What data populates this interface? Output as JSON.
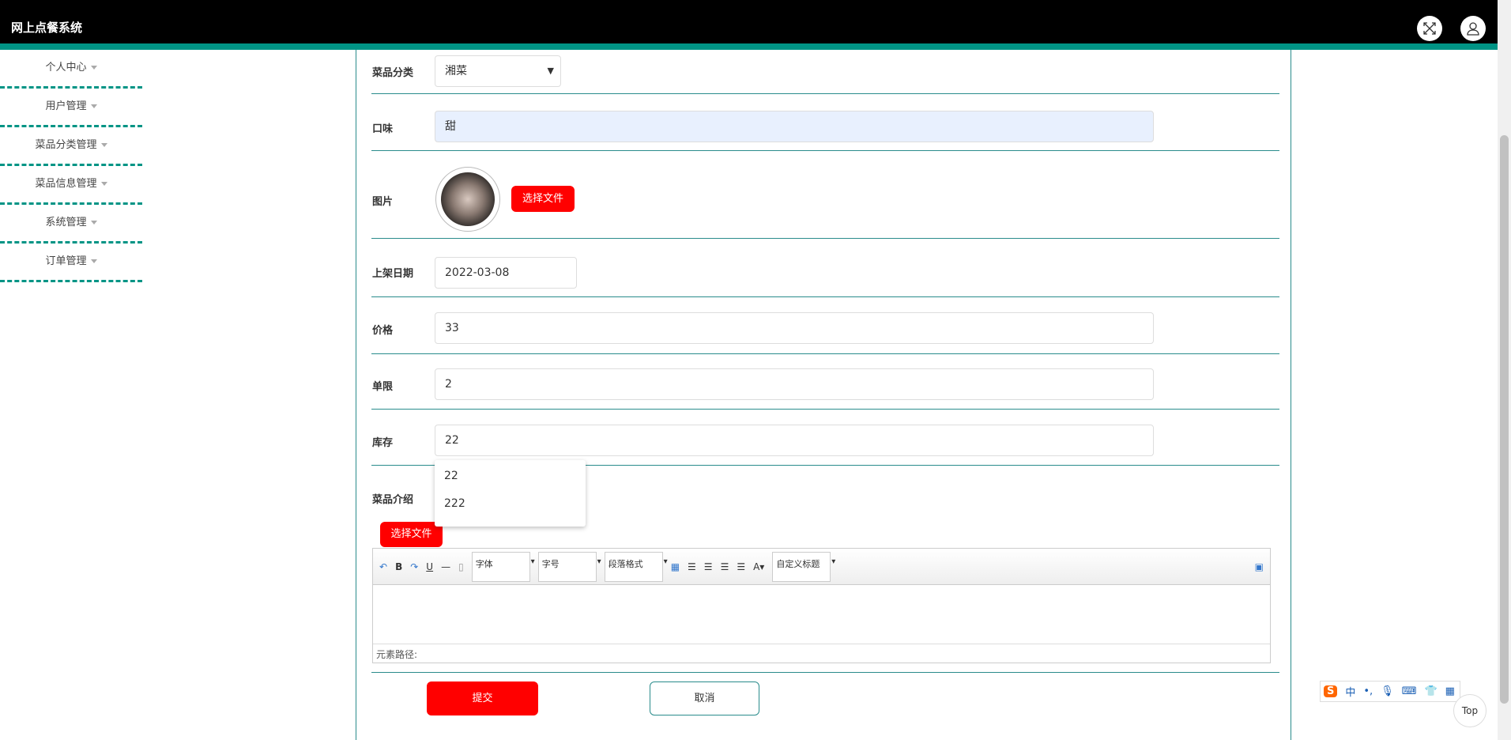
{
  "header": {
    "title": "网上点餐系统",
    "fullscreen_icon": "expand-icon",
    "user_icon": "user-icon"
  },
  "sidebar": {
    "items": [
      {
        "label": "个人中心"
      },
      {
        "label": "用户管理"
      },
      {
        "label": "菜品分类管理"
      },
      {
        "label": "菜品信息管理"
      },
      {
        "label": "系统管理"
      },
      {
        "label": "订单管理"
      }
    ]
  },
  "form": {
    "category": {
      "label": "菜品分类",
      "value": "湘菜"
    },
    "taste": {
      "label": "口味",
      "value": "甜"
    },
    "image": {
      "label": "图片",
      "button": "选择文件"
    },
    "date": {
      "label": "上架日期",
      "value": "2022-03-08"
    },
    "price": {
      "label": "价格",
      "value": "33"
    },
    "limit": {
      "label": "单限",
      "value": "2"
    },
    "stock": {
      "label": "库存",
      "value": "22",
      "suggestions": [
        "22",
        "222"
      ]
    },
    "intro": {
      "label": "菜品介绍",
      "button": "选择文件"
    },
    "editor": {
      "font": "字体",
      "size": "字号",
      "paragraph": "段落格式",
      "custom_title": "自定义标题",
      "path_label": "元素路径:"
    },
    "submit": "提交",
    "cancel": "取消"
  },
  "ime": {
    "lang": "中"
  },
  "top_button": "Top",
  "colors": {
    "accent": "#009485",
    "button_red": "#ff0000"
  }
}
